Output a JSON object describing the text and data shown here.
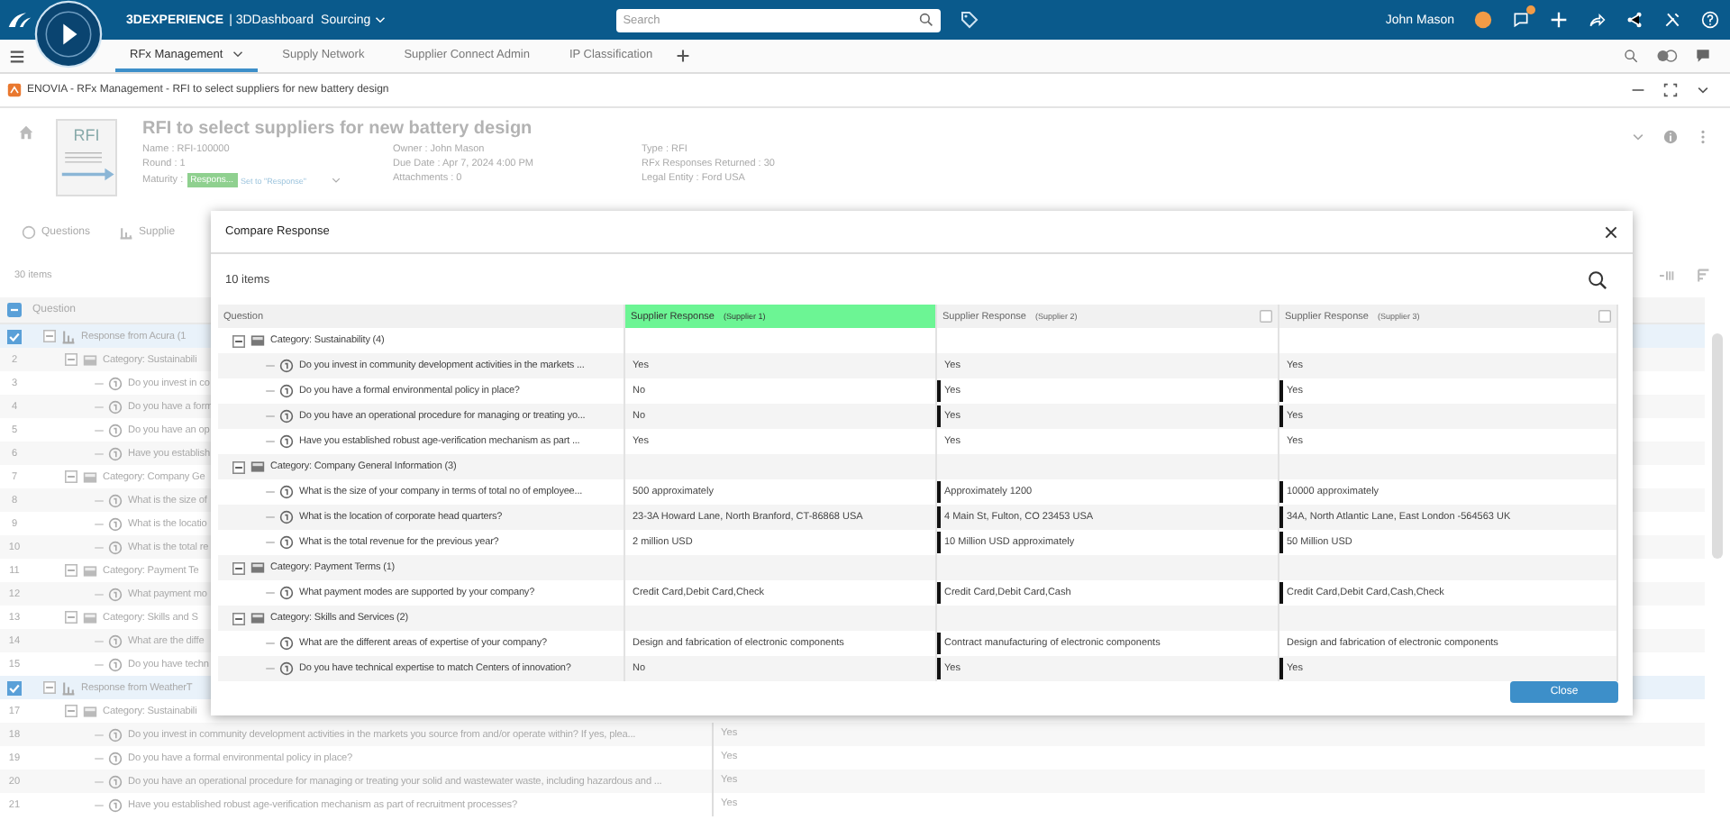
{
  "topbar": {
    "brand": "3DEXPERIENCE",
    "dashboard": "| 3DDashboard",
    "app": "Sourcing",
    "search": {
      "placeholder": "Search"
    },
    "user": "John Mason",
    "notification": true
  },
  "tabs": [
    {
      "label": "RFx Management",
      "selected": true
    },
    {
      "label": "Supply Network",
      "selected": false
    },
    {
      "label": "Supplier Connect Admin",
      "selected": false
    },
    {
      "label": "IP Classification",
      "selected": false
    }
  ],
  "app_title": "ENOVIA - RFx Management - RFI to select suppliers for new battery design",
  "rfi": {
    "icon_label": "RFI",
    "title": "RFI to select suppliers for new battery design",
    "fields": [
      {
        "kind": "text",
        "text": "Name : RFI-100000"
      },
      {
        "kind": "text",
        "text": "Owner : John Mason"
      },
      {
        "kind": "text",
        "text": "Type : RFI"
      },
      {
        "kind": "text",
        "text": "Round : 1"
      },
      {
        "kind": "text",
        "text": "Due Date : Apr 7, 2024 4:00 PM"
      },
      {
        "kind": "text",
        "text": "RFx Responses Returned : 30"
      },
      {
        "kind": "maturity",
        "text": "Maturity :",
        "state": "Respons...",
        "action": "Set to \"Response\""
      },
      {
        "kind": "text",
        "text": "Attachments : 0"
      },
      {
        "kind": "text",
        "text": "Legal Entity : Ford USA"
      }
    ]
  },
  "view_tabs": [
    {
      "label": "Questions"
    },
    {
      "label": "Supplie"
    }
  ],
  "count": "30 items",
  "questions_table": {
    "column": "Question",
    "select_all_indeterminate": true,
    "rows": [
      {
        "kind": "response",
        "checked": true,
        "expanded": true,
        "text": "Response from Acura (1",
        "children": [
          {
            "kind": "category",
            "num": "2",
            "expanded": true,
            "text": "Category: Sustainabili",
            "children": [
              {
                "kind": "question",
                "num": "3",
                "text": "Do you invest in co"
              },
              {
                "kind": "question",
                "num": "4",
                "text": "Do you have a form"
              },
              {
                "kind": "question",
                "num": "5",
                "text": "Do you have an op"
              },
              {
                "kind": "question",
                "num": "6",
                "text": "Have you establish"
              }
            ]
          },
          {
            "kind": "category",
            "num": "7",
            "expanded": true,
            "text": "Category: Company Ge",
            "children": [
              {
                "kind": "question",
                "num": "8",
                "text": "What is the size of"
              },
              {
                "kind": "question",
                "num": "9",
                "text": "What is the locatio"
              },
              {
                "kind": "question",
                "num": "10",
                "text": "What is the total re"
              }
            ]
          },
          {
            "kind": "category",
            "num": "11",
            "expanded": true,
            "text": "Category: Payment Te",
            "children": [
              {
                "kind": "question",
                "num": "12",
                "text": "What payment mo"
              }
            ]
          },
          {
            "kind": "category",
            "num": "13",
            "expanded": true,
            "text": "Category: Skills and S",
            "children": [
              {
                "kind": "question",
                "num": "14",
                "text": "What are the diffe"
              },
              {
                "kind": "question",
                "num": "15",
                "text": "Do you have techn"
              }
            ]
          }
        ]
      },
      {
        "kind": "response",
        "checked": true,
        "expanded": true,
        "text": "Response from WeatherT",
        "children": [
          {
            "kind": "category",
            "num": "17",
            "expanded": true,
            "text": "Category: Sustainabili",
            "children": [
              {
                "kind": "question",
                "num": "18",
                "text": "Do you invest in community development activities in the markets you source from and/or operate within? If yes, plea...",
                "answer": "Yes"
              },
              {
                "kind": "question",
                "num": "19",
                "text": "Do you have a formal environmental policy in place?",
                "answer": "Yes"
              },
              {
                "kind": "question",
                "num": "20",
                "text": "Do you have an operational procedure for managing or treating your solid and wastewater waste, including hazardous and ...",
                "answer": "Yes"
              },
              {
                "kind": "question",
                "num": "21",
                "text": "Have you established robust age-verification mechanism as part of recruitment processes?",
                "answer": "Yes"
              }
            ]
          }
        ]
      }
    ]
  },
  "dialog": {
    "title": "Compare Response",
    "count": "10 items",
    "columns": [
      {
        "label": "Question"
      },
      {
        "label": "Supplier Response",
        "supplier": "(Supplier 1)",
        "selected": true
      },
      {
        "label": "Supplier Response",
        "supplier": "(Supplier 2)",
        "selected": false,
        "checked": false
      },
      {
        "label": "Supplier Response",
        "supplier": "(Supplier 3)",
        "selected": false,
        "checked": false
      }
    ],
    "rows": [
      {
        "kind": "category",
        "expanded": true,
        "text": "Category: Sustainability (4)",
        "children": [
          {
            "kind": "question",
            "text": "Do you invest in community development activities in the markets ...",
            "answers": [
              {
                "text": "Yes",
                "differs": false
              },
              {
                "text": "Yes",
                "differs": false
              },
              {
                "text": "Yes",
                "differs": false
              }
            ]
          },
          {
            "kind": "question",
            "text": "Do you have a formal environmental policy in place?",
            "answers": [
              {
                "text": "No",
                "differs": false
              },
              {
                "text": "Yes",
                "differs": true
              },
              {
                "text": "Yes",
                "differs": true
              }
            ]
          },
          {
            "kind": "question",
            "text": "Do you have an operational procedure for managing or treating yo...",
            "answers": [
              {
                "text": "No",
                "differs": false
              },
              {
                "text": "Yes",
                "differs": true
              },
              {
                "text": "Yes",
                "differs": true
              }
            ]
          },
          {
            "kind": "question",
            "text": "Have you established robust age-verification mechanism as part ...",
            "answers": [
              {
                "text": "Yes",
                "differs": false
              },
              {
                "text": "Yes",
                "differs": false
              },
              {
                "text": "Yes",
                "differs": false
              }
            ]
          }
        ]
      },
      {
        "kind": "category",
        "expanded": true,
        "text": "Category: Company General Information (3)",
        "children": [
          {
            "kind": "question",
            "text": "What is the size of your company in terms of total no of employee...",
            "answers": [
              {
                "text": "500 approximately",
                "differs": false
              },
              {
                "text": "Approximately 1200",
                "differs": true
              },
              {
                "text": "10000 approximately",
                "differs": true
              }
            ]
          },
          {
            "kind": "question",
            "text": "What is the location of corporate head quarters?",
            "answers": [
              {
                "text": "23-3A Howard Lane, North Branford, CT-86868 USA",
                "differs": false
              },
              {
                "text": "4 Main St, Fulton, CO 23453 USA",
                "differs": true
              },
              {
                "text": "34A, North Atlantic Lane, East London -564563 UK",
                "differs": true
              }
            ]
          },
          {
            "kind": "question",
            "text": "What is the total revenue for the previous year?",
            "answers": [
              {
                "text": "2 million USD",
                "differs": false
              },
              {
                "text": "10 Million USD approximately",
                "differs": true
              },
              {
                "text": "50 Million USD",
                "differs": true
              }
            ]
          }
        ]
      },
      {
        "kind": "category",
        "expanded": true,
        "text": "Category: Payment Terms (1)",
        "children": [
          {
            "kind": "question",
            "text": "What payment modes are supported by your company?",
            "answers": [
              {
                "text": "Credit Card,Debit Card,Check",
                "differs": false
              },
              {
                "text": "Credit Card,Debit Card,Cash",
                "differs": true
              },
              {
                "text": "Credit Card,Debit Card,Cash,Check",
                "differs": true
              }
            ]
          }
        ]
      },
      {
        "kind": "category",
        "expanded": true,
        "text": "Category: Skills and Services (2)",
        "children": [
          {
            "kind": "question",
            "text": "What are the different areas of expertise of your company?",
            "answers": [
              {
                "text": "Design and fabrication of electronic components",
                "differs": false
              },
              {
                "text": "Contract manufacturing of electronic components",
                "differs": true
              },
              {
                "text": "Design and fabrication of electronic components",
                "differs": false
              }
            ]
          },
          {
            "kind": "question",
            "text": "Do you have technical expertise to match Centers of innovation?",
            "answers": [
              {
                "text": "No",
                "differs": false
              },
              {
                "text": "Yes",
                "differs": true
              },
              {
                "text": "Yes",
                "differs": true
              }
            ]
          }
        ]
      }
    ],
    "close": "Close"
  }
}
